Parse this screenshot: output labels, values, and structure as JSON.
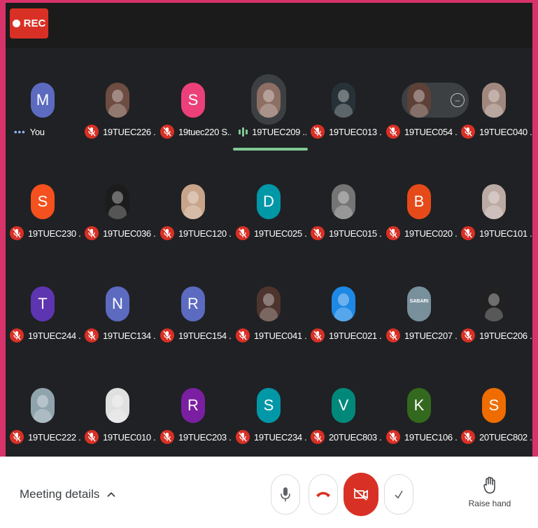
{
  "recording": {
    "label": "REC",
    "color": "#d93025"
  },
  "self_tile": {
    "initial": "M",
    "name": "You",
    "status_icon": "more-dots-icon",
    "avatar_color": "#5c6bc0"
  },
  "participants": [
    {
      "name": "19TUEC226 ...",
      "avatar": "photo",
      "color": "#6d4c41",
      "muted": true
    },
    {
      "name": "19tuec220 S...",
      "avatar": "letter",
      "initial": "S",
      "color": "#ec407a",
      "muted": true
    },
    {
      "name": "19TUEC209 ...",
      "avatar": "photo",
      "color": "#8d6e63",
      "muted": false,
      "speaking": true
    },
    {
      "name": "19TUEC013 ...",
      "avatar": "photo",
      "color": "#263238",
      "muted": true
    },
    {
      "name": "19TUEC054 ...",
      "avatar": "photo",
      "color": "#5d4037",
      "muted": true,
      "hovered": true
    },
    {
      "name": "19TUEC040 ...",
      "avatar": "photo",
      "color": "#a1887f",
      "muted": true
    },
    {
      "name": "19TUEC230 ...",
      "avatar": "letter",
      "initial": "S",
      "color": "#f4511e",
      "muted": true
    },
    {
      "name": "19TUEC036 ...",
      "avatar": "photo",
      "color": "#1c1c1c",
      "muted": true
    },
    {
      "name": "19TUEC120 ...",
      "avatar": "photo",
      "color": "#c8a58a",
      "muted": true
    },
    {
      "name": "19TUEC025 ...",
      "avatar": "letter",
      "initial": "D",
      "color": "#0097a7",
      "muted": true
    },
    {
      "name": "19TUEC015 ...",
      "avatar": "photo",
      "color": "#757575",
      "muted": true
    },
    {
      "name": "19TUEC020 ...",
      "avatar": "letter",
      "initial": "B",
      "color": "#e64a19",
      "muted": true
    },
    {
      "name": "19TUEC101 ...",
      "avatar": "photo",
      "color": "#bcaaa4",
      "muted": true
    },
    {
      "name": "19TUEC244 ...",
      "avatar": "letter",
      "initial": "T",
      "color": "#5e35b1",
      "muted": true
    },
    {
      "name": "19TUEC134 ...",
      "avatar": "letter",
      "initial": "N",
      "color": "#5c6bc0",
      "muted": true
    },
    {
      "name": "19TUEC154 ...",
      "avatar": "letter",
      "initial": "R",
      "color": "#5c6bc0",
      "muted": true
    },
    {
      "name": "19TUEC041 ...",
      "avatar": "photo",
      "color": "#4e342e",
      "muted": true
    },
    {
      "name": "19TUEC021 ...",
      "avatar": "photo",
      "color": "#1e88e5",
      "muted": true
    },
    {
      "name": "19TUEC207 ...",
      "avatar": "photo",
      "color": "#78909c",
      "muted": true,
      "photo_text": "SABARI"
    },
    {
      "name": "19TUEC206 ...",
      "avatar": "photo",
      "color": "#212121",
      "muted": true
    },
    {
      "name": "19TUEC222 ...",
      "avatar": "photo",
      "color": "#90a4ae",
      "muted": true
    },
    {
      "name": "19TUEC010 ...",
      "avatar": "photo",
      "color": "#e0e0e0",
      "muted": true
    },
    {
      "name": "19TUEC203 ...",
      "avatar": "letter",
      "initial": "R",
      "color": "#7b1fa2",
      "muted": true
    },
    {
      "name": "19TUEC234 ...",
      "avatar": "letter",
      "initial": "S",
      "color": "#0097a7",
      "muted": true
    },
    {
      "name": "20TUEC803 ...",
      "avatar": "letter",
      "initial": "V",
      "color": "#00897b",
      "muted": true
    },
    {
      "name": "19TUEC106 ...",
      "avatar": "letter",
      "initial": "K",
      "color": "#33691e",
      "muted": true
    },
    {
      "name": "20TUEC802 ...",
      "avatar": "letter",
      "initial": "S",
      "color": "#ef6c00",
      "muted": true
    }
  ],
  "toolbar": {
    "meeting_details_label": "Meeting details",
    "mic_icon": "microphone-icon",
    "leave_icon": "hang-up-icon",
    "camera_icon": "camera-off-icon",
    "more_icon": "checkmark-icon",
    "raise_hand_label": "Raise hand",
    "raise_hand_icon": "hand-icon"
  }
}
